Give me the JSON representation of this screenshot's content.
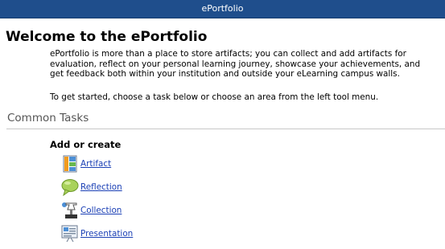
{
  "window": {
    "title": "ePortfolio"
  },
  "main": {
    "heading": "Welcome to the ePortfolio",
    "intro_lines": [
      "ePortfolio is more than a place to store artifacts; you can collect and add artifacts for",
      "evaluation, reflect on your personal learning journey, showcase your achievements, and",
      "get feedback both within your institution and outside your eLearning campus walls."
    ],
    "get_started": "To get started, choose a task below or choose an area from the left tool menu."
  },
  "common_tasks": {
    "title": "Common Tasks",
    "group_title": "Add or create",
    "items": [
      {
        "label": "Artifact",
        "icon": "artifact-icon"
      },
      {
        "label": "Reflection",
        "icon": "reflection-icon"
      },
      {
        "label": "Collection",
        "icon": "collection-icon"
      },
      {
        "label": "Presentation",
        "icon": "presentation-icon"
      }
    ]
  },
  "colors": {
    "titlebar": "#1f4e8c",
    "link": "#1a3fb5",
    "section_title": "#555555"
  }
}
